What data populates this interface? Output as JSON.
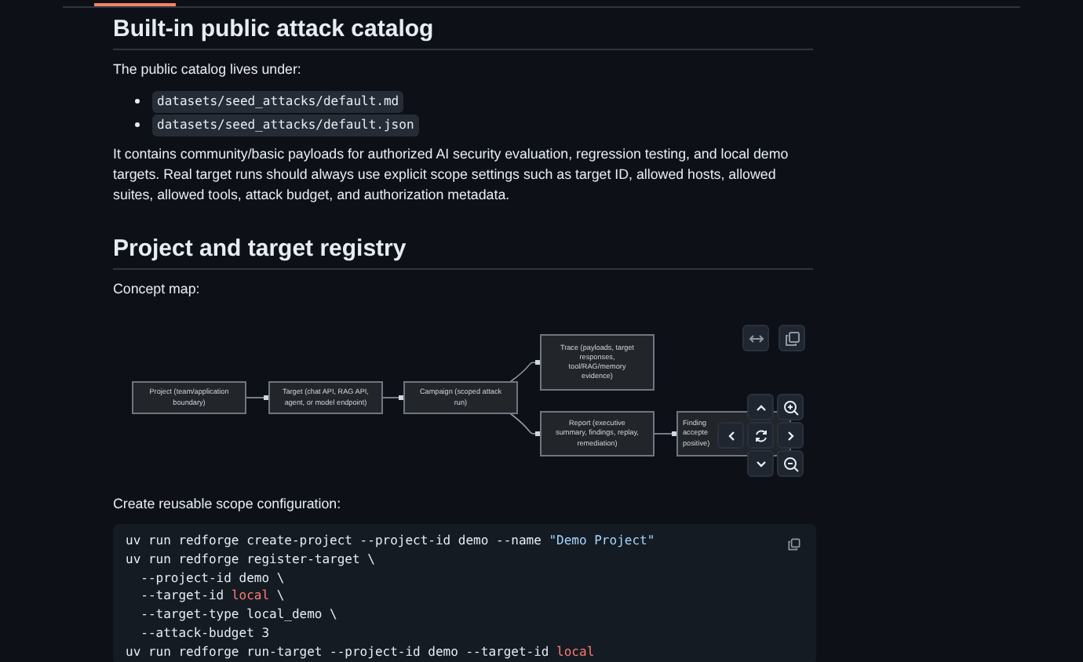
{
  "sections": [
    {
      "heading": "Built-in public attack catalog",
      "blocks": [
        {
          "kind": "paragraph",
          "text": "The public catalog lives under:"
        },
        {
          "kind": "list",
          "items": [
            "datasets/seed_attacks/default.md",
            "datasets/seed_attacks/default.json"
          ]
        },
        {
          "kind": "paragraph",
          "text": "It contains community/basic payloads for authorized AI security evaluation, regression testing, and local demo targets. Real target runs should always use explicit scope settings such as target ID, allowed hosts, allowed suites, allowed tools, attack budget, and authorization metadata."
        }
      ]
    },
    {
      "heading": "Project and target registry",
      "blocks": [
        {
          "kind": "paragraph",
          "text": "Concept map:"
        },
        {
          "kind": "diagram",
          "nodes": [
            {
              "lines": [
                "Project (team/application",
                "boundary)"
              ]
            },
            {
              "lines": [
                "Target (chat API, RAG API,",
                "agent, or model endpoint)"
              ]
            },
            {
              "lines": [
                "Campaign (scoped attack",
                "run)"
              ]
            },
            {
              "lines": [
                "Trace (payloads, target",
                "responses,",
                "tool/RAG/memory",
                "evidence)"
              ]
            },
            {
              "lines": [
                "Report (executive",
                "summary, findings, replay,",
                "remediation)"
              ]
            },
            {
              "lines": [
                "Finding",
                "accepte",
                "positive)"
              ]
            }
          ]
        },
        {
          "kind": "paragraph",
          "text": "Create reusable scope configuration:"
        },
        {
          "kind": "code",
          "lines": [
            [
              {
                "kind": "plain",
                "text": "uv run redforge create-project --project-id demo --name "
              },
              {
                "kind": "string",
                "text": "\"Demo Project\""
              }
            ],
            [
              {
                "kind": "plain",
                "text": "uv run redforge register-target \\"
              }
            ],
            [
              {
                "kind": "plain",
                "text": "  --project-id demo \\"
              }
            ],
            [
              {
                "kind": "plain",
                "text": "  --target-id "
              },
              {
                "kind": "keyword",
                "text": "local"
              },
              {
                "kind": "plain",
                "text": " \\"
              }
            ],
            [
              {
                "kind": "plain",
                "text": "  --target-type local_demo \\"
              }
            ],
            [
              {
                "kind": "plain",
                "text": "  --attack-budget 3"
              }
            ],
            [
              {
                "kind": "plain",
                "text": "uv run redforge run-target --project-id demo --target-id "
              },
              {
                "kind": "keyword",
                "text": "local"
              }
            ]
          ]
        }
      ]
    }
  ]
}
